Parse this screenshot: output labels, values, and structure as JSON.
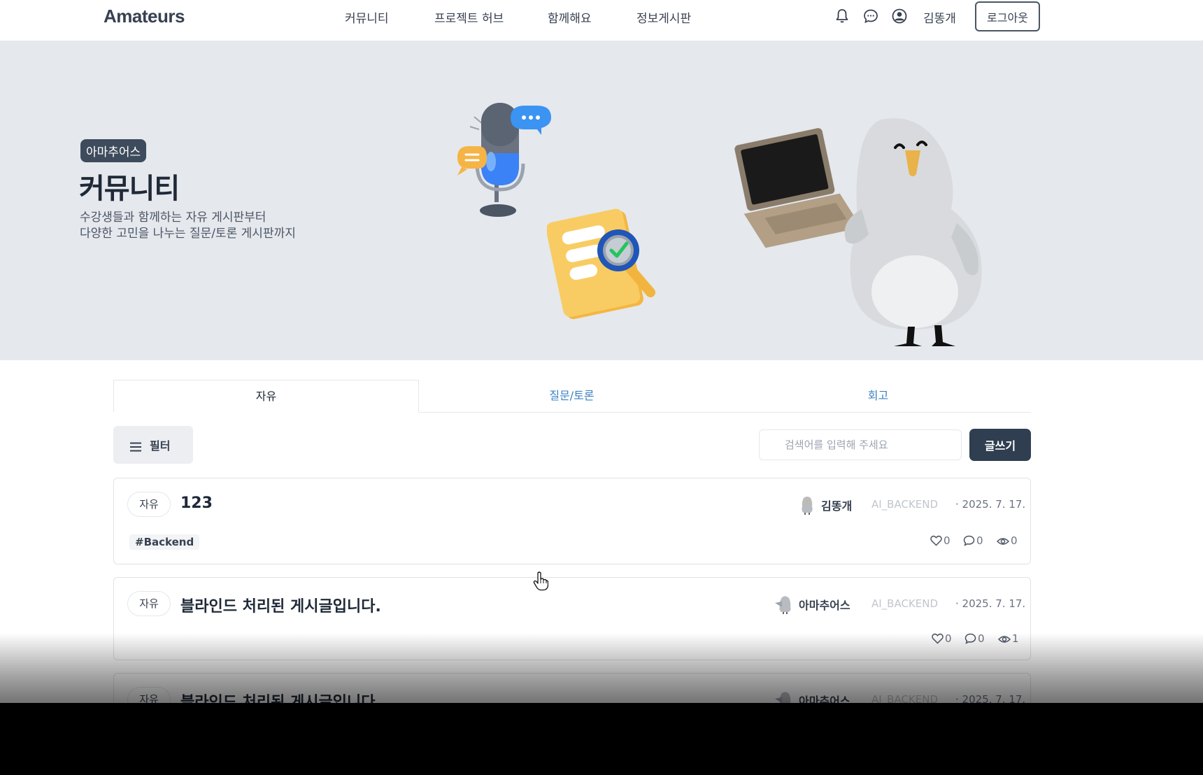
{
  "header": {
    "logo": "Amateurs",
    "nav": [
      "커뮤니티",
      "프로젝트 허브",
      "함께해요",
      "정보게시판"
    ],
    "icons": [
      "bell-icon",
      "chat-icon",
      "user-circle-icon"
    ],
    "username": "김똥개",
    "logout_label": "로그아웃"
  },
  "hero": {
    "badge": "아마추어스",
    "title": "커뮤니티",
    "desc_line1": "수강생들과 함께하는 자유 게시판부터",
    "desc_line2": "다양한 고민을 나누는 질문/토론 게시판까지"
  },
  "tabs": [
    {
      "label": "자유",
      "active": true
    },
    {
      "label": "질문/토론",
      "active": false
    },
    {
      "label": "회고",
      "active": false
    }
  ],
  "toolbar": {
    "filter_label": "필터",
    "search_placeholder": "검색어를 입력해 주세요",
    "write_label": "글쓰기"
  },
  "posts": [
    {
      "category": "자유",
      "title": "123",
      "tag": "#Backend",
      "author": "김똥개",
      "track": "AI_BACKEND",
      "date": "· 2025. 7. 17.",
      "likes": "0",
      "comments": "0",
      "views": "0"
    },
    {
      "category": "자유",
      "title": "블라인드 처리된 게시글입니다.",
      "author": "아마추어스",
      "track": "AI_BACKEND",
      "date": "· 2025. 7. 17.",
      "likes": "0",
      "comments": "0",
      "views": "1"
    },
    {
      "category": "자유",
      "title": "블라인드 처리된 게시글입니다.",
      "author": "아마추어스",
      "track": "AI_BACKEND",
      "date": "· 2025. 7. 17."
    }
  ],
  "colors": {
    "accent_dark": "#2f3e50",
    "tab_inactive": "#3b82c4",
    "hero_bg": "#e5e8ed"
  }
}
